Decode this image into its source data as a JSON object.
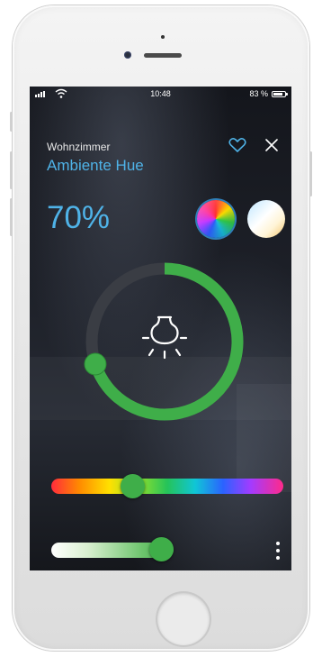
{
  "status_bar": {
    "time": "10:48",
    "battery_text": "83 %",
    "icons": [
      "signal-icon",
      "wifi-icon",
      "battery-icon"
    ]
  },
  "header": {
    "room": "Wohnzimmer",
    "device": "Ambiente Hue",
    "favorite_icon": "heart-outline-icon",
    "close_icon": "close-icon"
  },
  "brightness": {
    "display": "70%",
    "value": 0.7
  },
  "color_modes": [
    {
      "name": "color-mode-rainbow",
      "selected": true
    },
    {
      "name": "color-mode-white-temperature",
      "selected": false
    }
  ],
  "dial": {
    "level": 0.7,
    "center_icon": "light-bulb-icon"
  },
  "hue_slider": {
    "position": 0.35
  },
  "brightness_slider": {
    "position": 1.0
  },
  "more_icon": "vertical-dots-icon",
  "colors": {
    "accent_blue": "#4fb3e8",
    "accent_green": "#3fae49",
    "track_gray": "#3a3d44"
  }
}
